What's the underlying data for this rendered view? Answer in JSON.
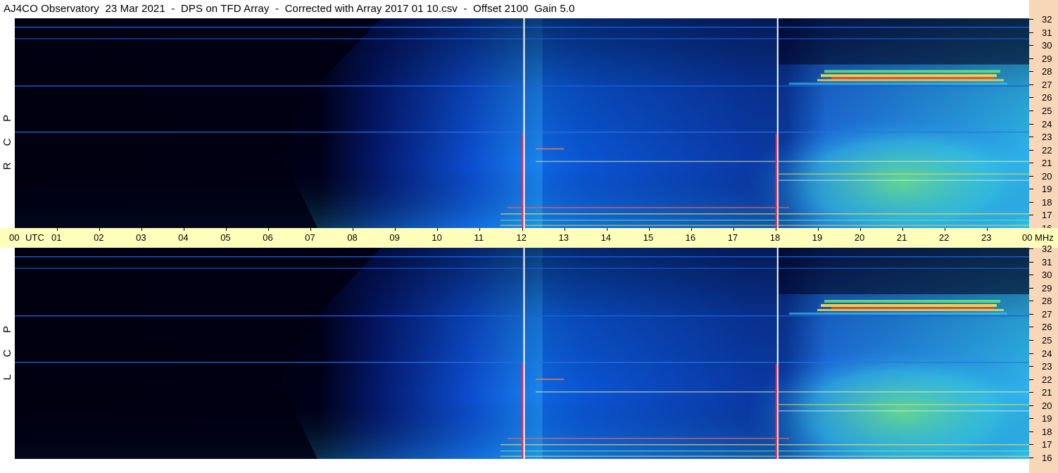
{
  "window": {
    "title": "AJ4CO Observatory  23 Mar 2021  -  DPS on TFD Array  -  Corrected with Array 2017 01 10.csv  -  Offset 2100  Gain 5.0"
  },
  "channels": [
    {
      "id": "rcp",
      "letters": [
        "R",
        "C",
        "P"
      ]
    },
    {
      "id": "lcp",
      "letters": [
        "L",
        "C",
        "P"
      ]
    }
  ],
  "time_axis": {
    "start_label": "00",
    "utc_label": "UTC",
    "hours": [
      "01",
      "02",
      "03",
      "04",
      "05",
      "06",
      "07",
      "08",
      "09",
      "10",
      "11",
      "12",
      "13",
      "14",
      "15",
      "16",
      "17",
      "18",
      "19",
      "20",
      "21",
      "22",
      "23"
    ],
    "end_label": "00",
    "unit_label": "MHz"
  },
  "frequency_axis": {
    "labels": [
      "32",
      "31",
      "30",
      "29",
      "28",
      "27",
      "26",
      "25",
      "24",
      "23",
      "22",
      "21",
      "20",
      "19",
      "18",
      "17",
      "16"
    ]
  },
  "colors": {
    "background_dark": "#000010",
    "blue_low": "#0a2a9a",
    "blue_mid": "#1060e0",
    "cyan": "#3ad6f0",
    "green": "#70f070",
    "yellow": "#ffe040",
    "red": "#ff3030",
    "time_bar": "#ffffbb",
    "scale_bar": "#f8d6b8"
  },
  "chart_data": {
    "type": "heatmap",
    "title": "AJ4CO Observatory  23 Mar 2021  -  DPS on TFD Array  -  Corrected with Array 2017 01 10.csv  -  Offset 2100  Gain 5.0",
    "xlabel": "UTC",
    "ylabel": "MHz",
    "xlim": [
      0,
      24
    ],
    "ylim": [
      16,
      32
    ],
    "panels": [
      "R C P",
      "L C P"
    ],
    "vertical_markers_utc": [
      12.05,
      18.05
    ]
  }
}
